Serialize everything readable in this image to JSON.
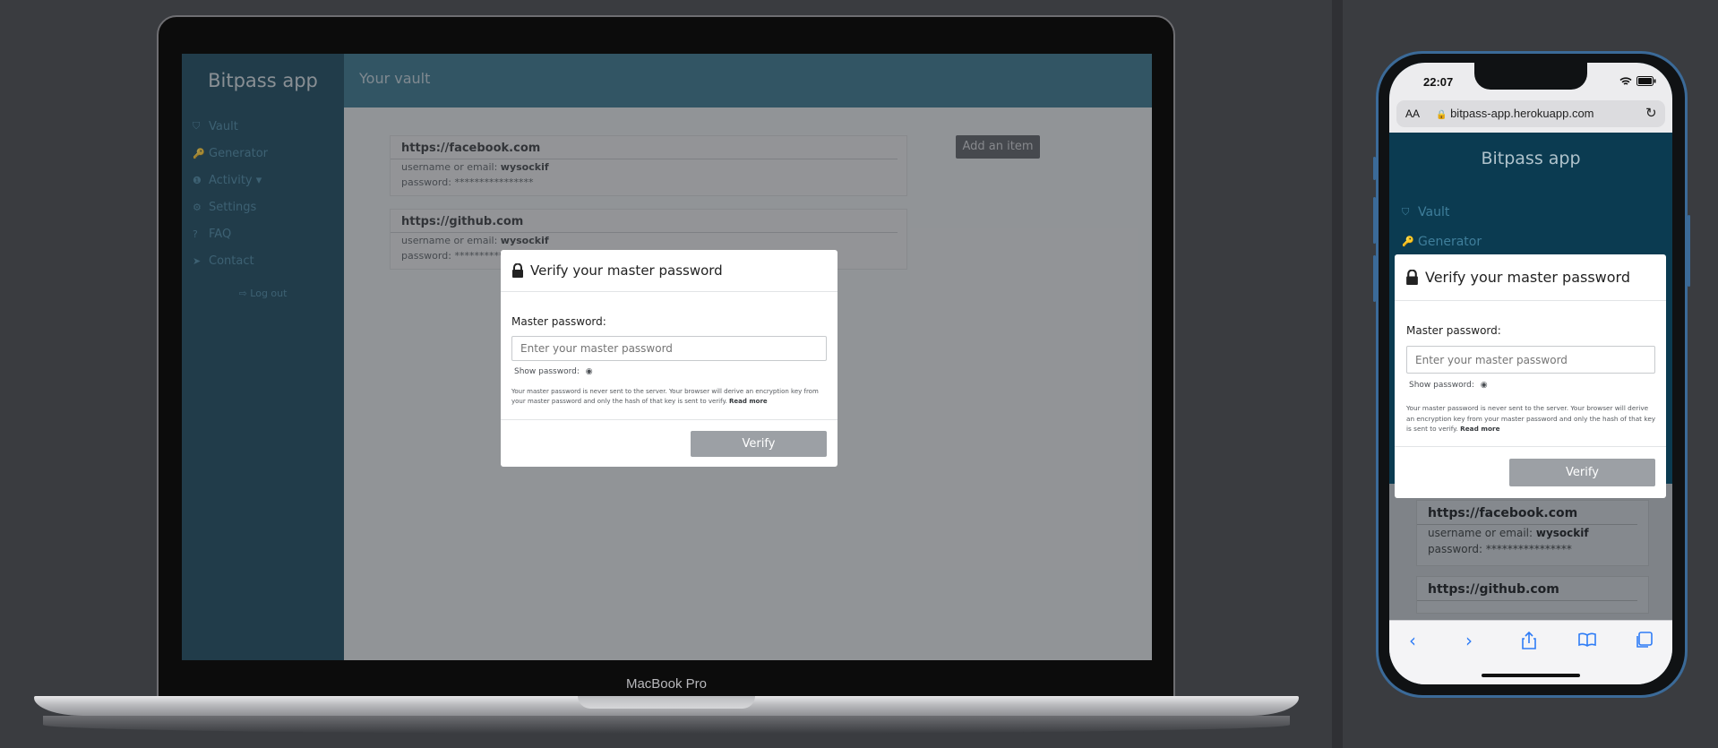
{
  "desktop": {
    "device_label": "MacBook Pro",
    "app": {
      "brand": "Bitpass app",
      "page_title": "Your vault",
      "nav": [
        {
          "icon": "shield-icon",
          "glyph": "⛉",
          "label": "Vault"
        },
        {
          "icon": "key-icon",
          "glyph": "🔑",
          "label": "Generator"
        },
        {
          "icon": "info-icon",
          "glyph": "❶",
          "label": "Activity ▾"
        },
        {
          "icon": "gear-icon",
          "glyph": "⚙",
          "label": "Settings"
        },
        {
          "icon": "question-icon",
          "glyph": "?",
          "label": "FAQ"
        },
        {
          "icon": "send-icon",
          "glyph": "➤",
          "label": "Contact"
        }
      ],
      "logout": "⇨ Log out",
      "add_button": "Add an item",
      "items": [
        {
          "site": "https://facebook.com",
          "user_label": "username or email:",
          "user": "wysockif",
          "pass_label": "password:",
          "pass": "****************"
        },
        {
          "site": "https://github.com",
          "user_label": "username or email:",
          "user": "wysockif",
          "pass_label": "password:",
          "pass": "****************"
        }
      ]
    }
  },
  "modal": {
    "title": "Verify your master password",
    "field_label": "Master password:",
    "placeholder": "Enter your master password",
    "show_password": "Show password:",
    "note": "Your master password is never sent to the server. Your browser will derive an encryption key from your master password and only the hash of that key is sent to verify.",
    "read_more": "Read more",
    "verify": "Verify"
  },
  "mobile": {
    "time": "22:07",
    "url": "bitpass-app.herokuapp.com",
    "aa": "AA",
    "brand": "Bitpass app",
    "nav": [
      {
        "icon": "shield-icon",
        "glyph": "⛉",
        "label": "Vault"
      },
      {
        "icon": "key-icon",
        "glyph": "🔑",
        "label": "Generator"
      }
    ],
    "items": [
      {
        "site": "https://facebook.com",
        "user_label": "username or email:",
        "user": "wysockif",
        "pass_label": "password:",
        "pass": "****************"
      },
      {
        "site": "https://github.com"
      }
    ]
  },
  "colors": {
    "sidebar": "#0b3b51",
    "topbar": "#2b6980",
    "verify_button": "#9ca0a5",
    "phone_frame": "#3b6a98"
  }
}
